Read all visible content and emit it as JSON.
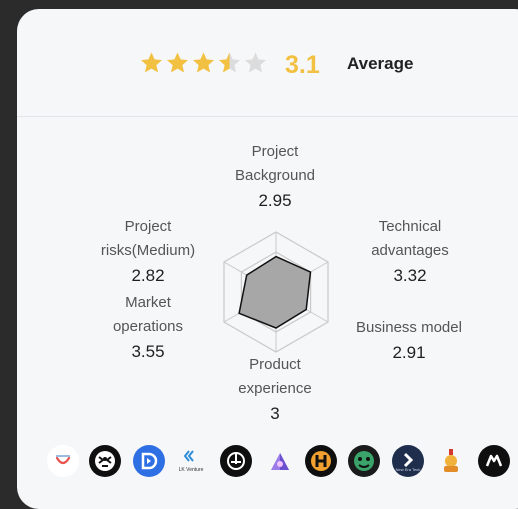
{
  "rating": {
    "score": "3.1",
    "label": "Average",
    "stars_filled": 3.1,
    "stars_total": 5,
    "star_color": "#f2c142",
    "star_empty_color": "#dcdcdc"
  },
  "radar": {
    "project_background": {
      "label_line1": "Project",
      "label_line2": "Background",
      "value": "2.95"
    },
    "technical_advantages": {
      "label_line1": "Technical",
      "label_line2": "advantages",
      "value": "3.32"
    },
    "business_model": {
      "label_line1": "Business model",
      "value": "2.91"
    },
    "product_experience": {
      "label_line1": "Product",
      "label_line2": "experience",
      "value": "3"
    },
    "market_operations": {
      "label_line1": "Market",
      "label_line2": "operations",
      "value": "3.55"
    },
    "project_risks": {
      "label_line1": "Project",
      "label_line2": "risks(Medium)",
      "value": "2.82"
    },
    "fill_color": "#a7a7a7",
    "grid_color": "#c9c9c9"
  },
  "investor_logos": [
    {
      "icon": "smile-logo-icon"
    },
    {
      "icon": "tiger-logo-icon"
    },
    {
      "icon": "blue-d-logo-icon"
    },
    {
      "icon": "lk-venture-logo-icon",
      "text": "LK Venture"
    },
    {
      "icon": "black-circle-logo-icon"
    },
    {
      "icon": "purple-house-logo-icon"
    },
    {
      "icon": "orange-h-logo-icon"
    },
    {
      "icon": "green-face-logo-icon"
    },
    {
      "icon": "navy-s-logo-icon",
      "text": "New Era Tech"
    },
    {
      "icon": "gold-tiger-logo-icon"
    },
    {
      "icon": "black-diamond-logo-icon"
    }
  ]
}
